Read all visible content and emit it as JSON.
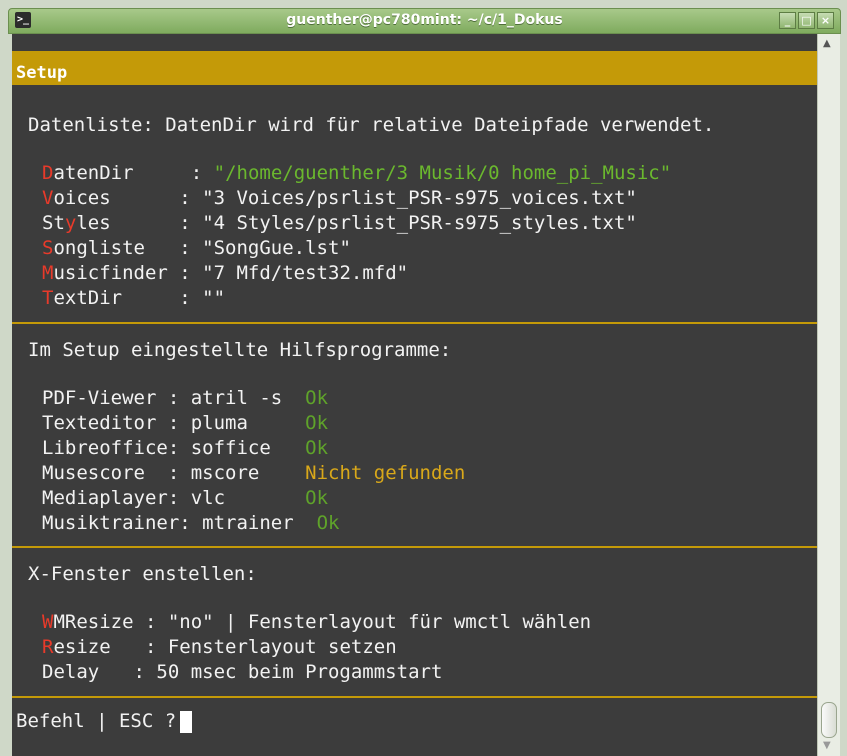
{
  "window": {
    "title": "guenther@pc780mint: ~/c/1_Dokus",
    "icon": "terminal-icon",
    "buttons": [
      "minimize",
      "maximize",
      "close"
    ]
  },
  "header": {
    "label": "Setup"
  },
  "section1": {
    "heading": "Datenliste: DatenDir wird für relative Dateipfade verwendet.",
    "rows": [
      {
        "key_first": "D",
        "key_rest": "atenDir    ",
        "value": "\"/home/guenther/3 Musik/0 home_pi_Music\""
      },
      {
        "key_first": "V",
        "key_rest": "oices     ",
        "value": "\"3 Voices/psrlist_PSR-s975_voices.txt\""
      },
      {
        "key_pre": "St",
        "key_first": "y",
        "key_rest": "les     ",
        "value": "\"4 Styles/psrlist_PSR-s975_styles.txt\""
      },
      {
        "key_first": "S",
        "key_rest": "ongliste  ",
        "value": "\"SongGue.lst\""
      },
      {
        "key_first": "M",
        "key_rest": "usicfinder",
        "value": "\"7 Mfd/test32.mfd\""
      },
      {
        "key_first": "T",
        "key_rest": "extDir    ",
        "value": "\"\""
      }
    ]
  },
  "section2": {
    "heading": "Im Setup eingestellte Hilfsprogramme:",
    "rows": [
      {
        "name": "PDF-Viewer ",
        "value": "atril -s  ",
        "status": "Ok"
      },
      {
        "name": "Texteditor ",
        "value": "pluma     ",
        "status": "Ok"
      },
      {
        "name": "Libreoffice",
        "value": "soffice   ",
        "status": "Ok"
      },
      {
        "name": "Musescore  ",
        "value": "mscore    ",
        "status": "Nicht gefunden"
      },
      {
        "name": "Mediaplayer",
        "value": "vlc       ",
        "status": "Ok"
      },
      {
        "name": "Musiktrainer",
        "value": "mtrainer  ",
        "status": "Ok"
      }
    ]
  },
  "section3": {
    "heading": "X-Fenster enstellen:",
    "rows": [
      {
        "key_first": "W",
        "key_rest": "MResize",
        "value": "\"no\" | Fensterlayout für wmctl wählen"
      },
      {
        "key_first": "R",
        "key_rest": "esize  ",
        "value": "Fensterlayout setzen"
      },
      {
        "key_first": "",
        "key_rest": "Delay  ",
        "value": "50 msec beim Progammstart"
      }
    ]
  },
  "prompt": {
    "text": "Befehl | ESC ?"
  },
  "colors": {
    "header": "#c49a08",
    "hotkey": "#e83a2a",
    "path": "#6bb82e",
    "ok": "#5fa32a",
    "warn": "#d9a81a",
    "background": "#3c3c3c"
  }
}
